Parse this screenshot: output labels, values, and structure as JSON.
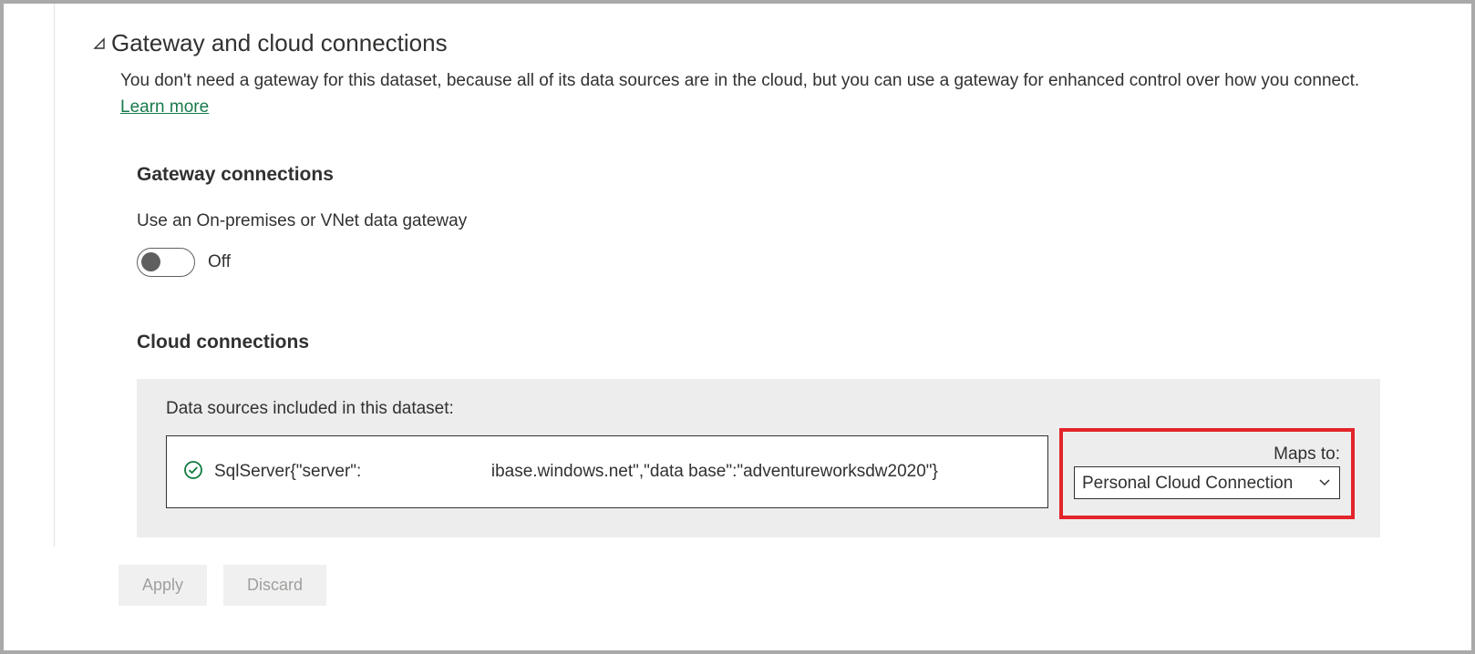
{
  "section": {
    "title": "Gateway and cloud connections",
    "description_pre": "You don't need a gateway for this dataset, because all of its data sources are in the cloud, but you can use a gateway for enhanced control over how you connect. ",
    "learn_more": "Learn more"
  },
  "gateway": {
    "heading": "Gateway connections",
    "label": "Use an On-premises or VNet data gateway",
    "toggle_state": "Off"
  },
  "cloud": {
    "heading": "Cloud connections",
    "box_label": "Data sources included in this dataset:",
    "datasource_text": "SqlServer{\"server\":                           ibase.windows.net\",\"data base\":\"adventureworksdw2020\"}",
    "maps_to_label": "Maps to:",
    "maps_to_value": "Personal Cloud Connection"
  },
  "buttons": {
    "apply": "Apply",
    "discard": "Discard"
  }
}
